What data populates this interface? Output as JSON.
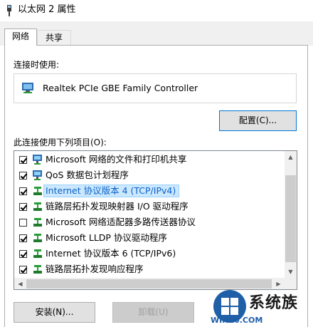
{
  "window": {
    "title": "以太网 2 属性"
  },
  "tabs": [
    {
      "label": "网络",
      "active": true
    },
    {
      "label": "共享",
      "active": false
    }
  ],
  "connect_using": {
    "label": "连接时使用:",
    "adapter": "Realtek PCIe GBE Family Controller",
    "configure_button": "配置(C)..."
  },
  "items": {
    "label": "此连接使用下列项目(O):",
    "list": [
      {
        "text": "Microsoft 网络的文件和打印机共享",
        "checked": true,
        "icon": "network-client-icon"
      },
      {
        "text": "QoS 数据包计划程序",
        "checked": true,
        "icon": "network-client-icon"
      },
      {
        "text": "Internet 协议版本 4 (TCP/IPv4)",
        "checked": true,
        "icon": "protocol-icon",
        "selected": true
      },
      {
        "text": "链路层拓扑发现映射器 I/O 驱动程序",
        "checked": true,
        "icon": "protocol-icon"
      },
      {
        "text": "Microsoft 网络适配器多路传送器协议",
        "checked": false,
        "icon": "protocol-icon"
      },
      {
        "text": "Microsoft LLDP 协议驱动程序",
        "checked": true,
        "icon": "protocol-icon"
      },
      {
        "text": "Internet 协议版本 6 (TCP/IPv6)",
        "checked": true,
        "icon": "protocol-icon"
      },
      {
        "text": "链路层拓扑发现响应程序",
        "checked": true,
        "icon": "protocol-icon"
      }
    ]
  },
  "buttons": {
    "install": "安装(N)...",
    "uninstall": "卸载(U)"
  },
  "watermark": {
    "brand": "系统族",
    "url": "WIN10.COM"
  },
  "colors": {
    "selection_bg": "#cce8ff",
    "selection_text": "#0b62c6",
    "focus_border": "#0078d7"
  }
}
